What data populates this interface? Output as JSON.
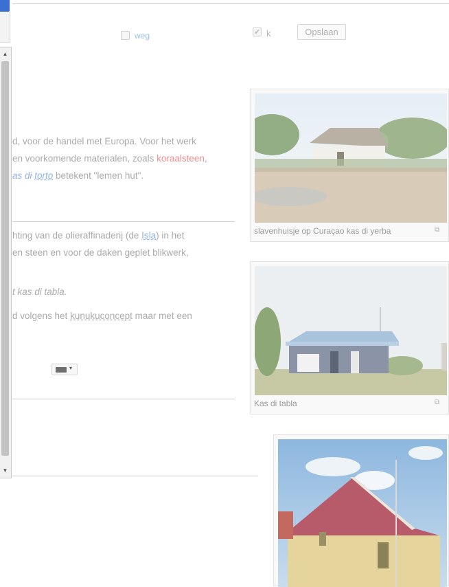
{
  "toolbar": {
    "weg_label": "weg",
    "k_label": "k",
    "save_label": "Opslaan"
  },
  "article": {
    "p1_line1": "d, voor de handel met Europa. Voor het werk",
    "p1_line2_a": "en voorkomende materialen, zoals ",
    "p1_line2_link": "koraalsteen",
    "p1_line2_end": ",",
    "p1_line3_a": "as di ",
    "p1_line3_link": "torto",
    "p1_line3_b": " betekent \"lemen hut\".",
    "p2_line1_a": "hting van de olieraffinaderij (de ",
    "p2_line1_link": "Isla",
    "p2_line1_b": ") in het",
    "p2_line2": "en steen en voor de daken geplet blikwerk,",
    "p2_line3": "t kas di tabla.",
    "p2_line4_a": "d volgens het ",
    "p2_line4_link": "kunukuconcept",
    "p2_line4_b": " maar met een"
  },
  "figures": [
    {
      "caption": "slavenhuisje op Curaçao kas di yerba",
      "icon": "magnify-icon"
    },
    {
      "caption": "Kas di tabla",
      "icon": "magnify-icon"
    },
    {
      "caption": "",
      "icon": ""
    }
  ],
  "icons": {
    "scroll_up": "▲",
    "scroll_down": "▼",
    "check": "✔",
    "magnify": "⧉",
    "caret": "▾"
  }
}
